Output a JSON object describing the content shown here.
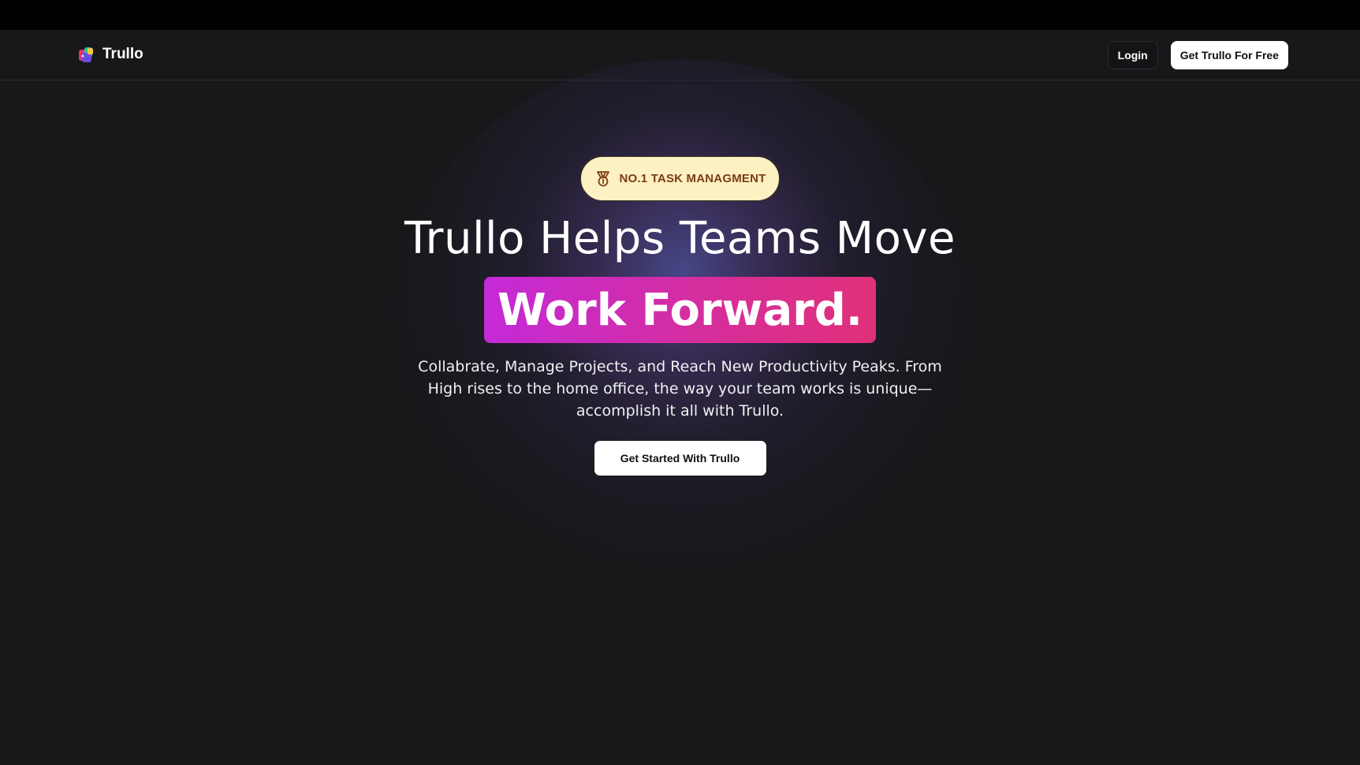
{
  "nav": {
    "brand_name": "Trullo",
    "login_label": "Login",
    "cta_label": "Get Trullo For Free"
  },
  "hero": {
    "badge_icon": "medal-icon",
    "badge_text": "NO.1 TASK MANAGMENT",
    "headline": "Trullo Helps Teams Move",
    "highlight": "Work Forward.",
    "subtitle": "Collabrate, Manage Projects, and Reach New Productivity Peaks. From High rises to the home office, the way your team works is unique—accomplish it all with Trullo.",
    "cta_label": "Get Started With Trullo"
  },
  "colors": {
    "background": "#18181b",
    "badge_bg": "#fdf0c2",
    "badge_text": "#7a3d12",
    "highlight_start": "#c42ad8",
    "highlight_end": "#e0307a"
  }
}
